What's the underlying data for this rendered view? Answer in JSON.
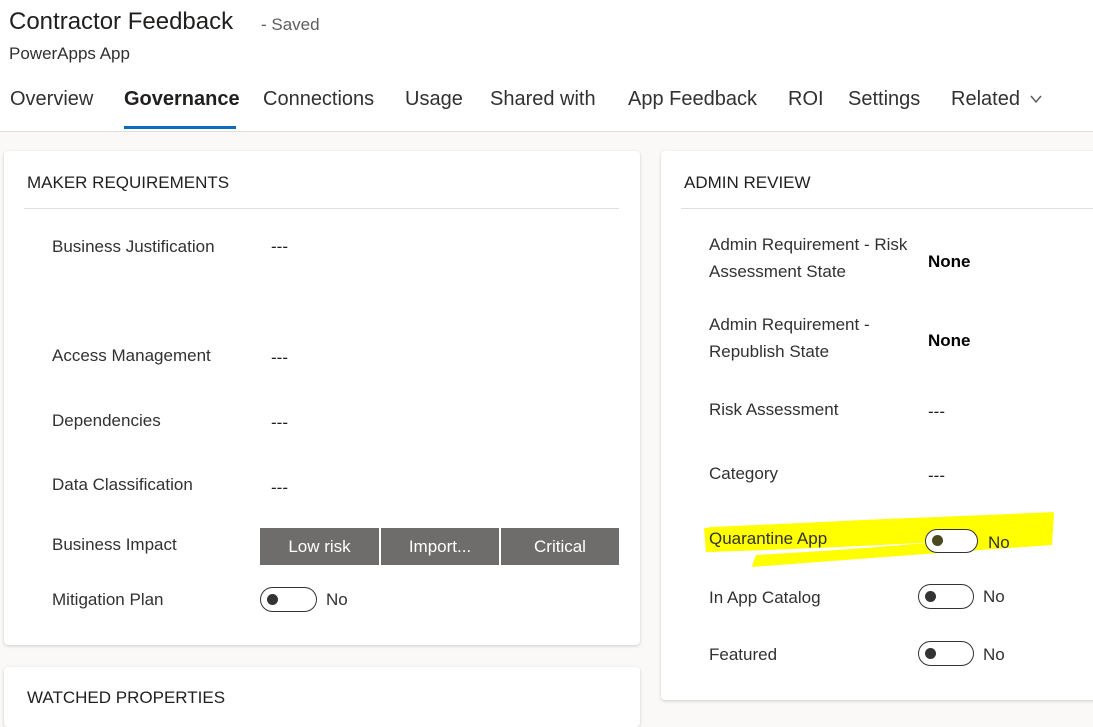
{
  "header": {
    "title": "Contractor Feedback",
    "saved": "- Saved",
    "subtitle": "PowerApps App",
    "tabs": [
      "Overview",
      "Governance",
      "Connections",
      "Usage",
      "Shared with",
      "App Feedback",
      "ROI",
      "Settings",
      "Related"
    ]
  },
  "maker": {
    "title": "MAKER REQUIREMENTS",
    "business_justification": {
      "label": "Business Justification",
      "value": "---"
    },
    "access_management": {
      "label": "Access Management",
      "value": "---"
    },
    "dependencies": {
      "label": "Dependencies",
      "value": "---"
    },
    "data_classification": {
      "label": "Data Classification",
      "value": "---"
    },
    "business_impact": {
      "label": "Business Impact",
      "options": [
        "Low risk",
        "Import...",
        "Critical"
      ]
    },
    "mitigation_plan": {
      "label": "Mitigation Plan",
      "value": "No"
    }
  },
  "admin": {
    "title": "ADMIN REVIEW",
    "risk_state": {
      "label": "Admin Requirement - Risk Assessment State",
      "value": "None"
    },
    "republish_state": {
      "label": "Admin Requirement - Republish State",
      "value": "None"
    },
    "risk_assessment": {
      "label": "Risk Assessment",
      "value": "---"
    },
    "category": {
      "label": "Category",
      "value": "---"
    },
    "quarantine": {
      "label": "Quarantine App",
      "value": "No"
    },
    "in_catalog": {
      "label": "In App Catalog",
      "value": "No"
    },
    "featured": {
      "label": "Featured",
      "value": "No"
    }
  },
  "watched": {
    "title": "WATCHED PROPERTIES"
  },
  "colors": {
    "accent": "#0f6cbd",
    "highlight": "#ffff00",
    "segment": "#6e6d6c"
  },
  "icons": {
    "related_dropdown": "chevron-down-icon"
  }
}
